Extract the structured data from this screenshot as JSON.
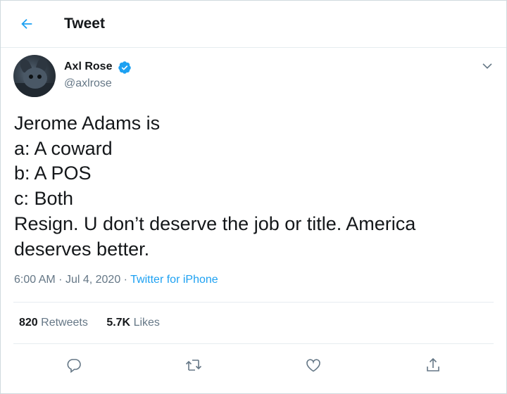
{
  "header": {
    "title": "Tweet",
    "back_icon": "arrow-left-icon"
  },
  "author": {
    "name": "Axl Rose",
    "handle": "@axlrose",
    "verified": true,
    "verified_icon": "verified-badge-icon"
  },
  "tweet": {
    "lines": [
      "Jerome Adams is",
      "a: A coward",
      "b: A POS",
      "c: Both",
      "Resign. U don’t deserve the job or title. America",
      "deserves better."
    ]
  },
  "meta": {
    "time": "6:00 AM",
    "sep1": "·",
    "date": "Jul 4, 2020",
    "sep2": "·",
    "source": "Twitter for iPhone"
  },
  "stats": {
    "retweets_count": "820",
    "retweets_label": "Retweets",
    "likes_count": "5.7K",
    "likes_label": "Likes"
  },
  "actions": {
    "reply_icon": "reply-icon",
    "retweet_icon": "retweet-icon",
    "like_icon": "heart-icon",
    "share_icon": "share-icon"
  },
  "colors": {
    "accent": "#1da1f2",
    "secondary_text": "#657786",
    "primary_text": "#14171a",
    "border": "#e6ecf0"
  }
}
